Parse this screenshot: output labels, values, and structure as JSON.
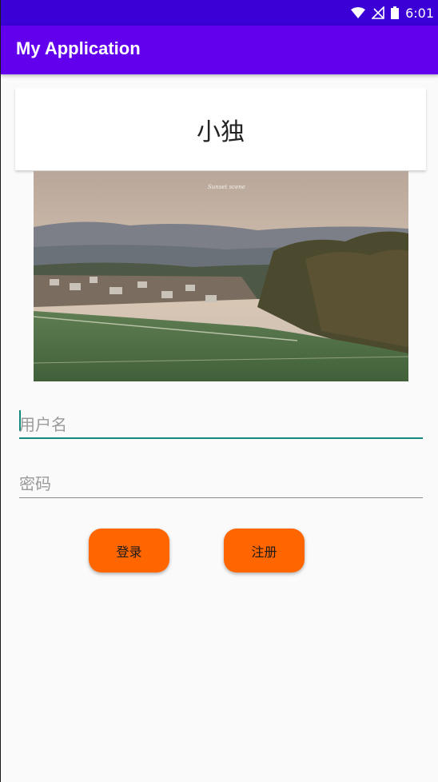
{
  "status_bar": {
    "time": "6:01",
    "background": "#3a00d6"
  },
  "app_bar": {
    "title": "My Application",
    "background": "#6200ee"
  },
  "header_card": {
    "title": "小独"
  },
  "banner": {
    "caption": "Sunset scene"
  },
  "form": {
    "username_placeholder": "用户名",
    "password_placeholder": "密码",
    "focus_color": "#128a7e"
  },
  "buttons": {
    "login_label": "登录",
    "register_label": "注册",
    "color": "#ff6600"
  }
}
